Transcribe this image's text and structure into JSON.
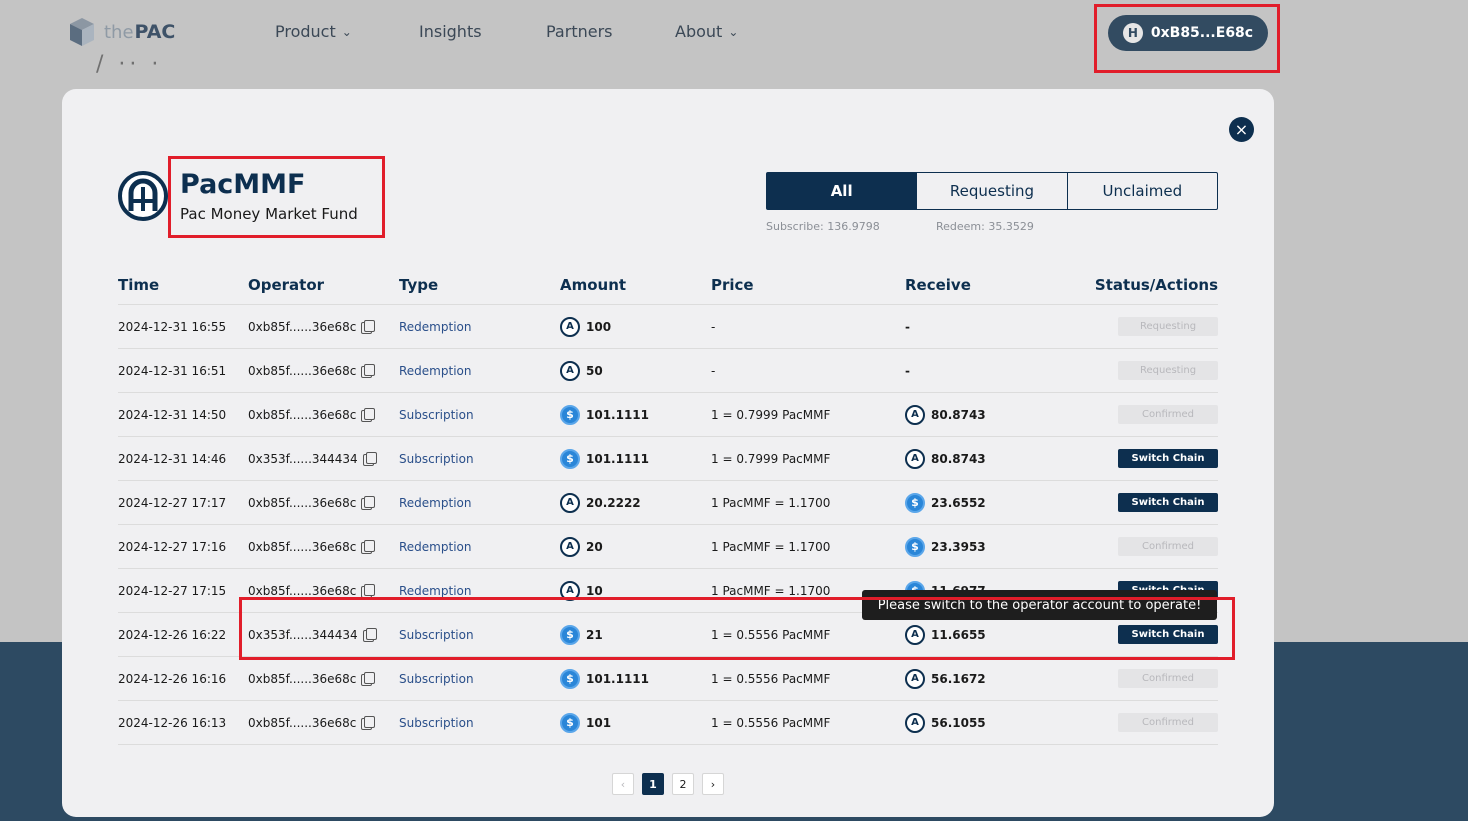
{
  "nav": {
    "logo_the": "the",
    "logo_pac": "PAC",
    "items": [
      {
        "label": "Product",
        "has_dropdown": true
      },
      {
        "label": "Insights",
        "has_dropdown": false
      },
      {
        "label": "Partners",
        "has_dropdown": false
      },
      {
        "label": "About",
        "has_dropdown": true
      }
    ],
    "wallet": {
      "address": "0xB85...E68c",
      "icon": "H"
    }
  },
  "modal": {
    "close_icon": "×",
    "fund": {
      "name": "PacMMF",
      "subtitle": "Pac Money Market Fund"
    },
    "tabs": [
      {
        "label": "All",
        "active": true
      },
      {
        "label": "Requesting",
        "active": false
      },
      {
        "label": "Unclaimed",
        "active": false
      }
    ],
    "summary": {
      "subscribe": "Subscribe: 136.9798",
      "redeem": "Redeem: 35.3529"
    },
    "columns": {
      "time": "Time",
      "operator": "Operator",
      "type": "Type",
      "amount": "Amount",
      "price": "Price",
      "receive": "Receive",
      "status": "Status/Actions"
    },
    "rows": [
      {
        "time": "2024-12-31 16:55",
        "operator": "0xb85f......36e68c",
        "type": "Redemption",
        "amount_coin": "pac",
        "amount": "100",
        "price": "-",
        "receive_coin": "",
        "receive": "-",
        "status": "Requesting",
        "status_kind": "disabled"
      },
      {
        "time": "2024-12-31 16:51",
        "operator": "0xb85f......36e68c",
        "type": "Redemption",
        "amount_coin": "pac",
        "amount": "50",
        "price": "-",
        "receive_coin": "",
        "receive": "-",
        "status": "Requesting",
        "status_kind": "disabled"
      },
      {
        "time": "2024-12-31 14:50",
        "operator": "0xb85f......36e68c",
        "type": "Subscription",
        "amount_coin": "usd",
        "amount": "101.1111",
        "price": "1 = 0.7999 PacMMF",
        "receive_coin": "pac",
        "receive": "80.8743",
        "status": "Confirmed",
        "status_kind": "disabled"
      },
      {
        "time": "2024-12-31 14:46",
        "operator": "0x353f......344434",
        "type": "Subscription",
        "amount_coin": "usd",
        "amount": "101.1111",
        "price": "1 = 0.7999 PacMMF",
        "receive_coin": "pac",
        "receive": "80.8743",
        "status": "Switch Chain",
        "status_kind": "action"
      },
      {
        "time": "2024-12-27 17:17",
        "operator": "0xb85f......36e68c",
        "type": "Redemption",
        "amount_coin": "pac",
        "amount": "20.2222",
        "price": "1 PacMMF = 1.1700",
        "receive_coin": "usd",
        "receive": "23.6552",
        "status": "Switch Chain",
        "status_kind": "action"
      },
      {
        "time": "2024-12-27 17:16",
        "operator": "0xb85f......36e68c",
        "type": "Redemption",
        "amount_coin": "pac",
        "amount": "20",
        "price": "1 PacMMF = 1.1700",
        "receive_coin": "usd",
        "receive": "23.3953",
        "status": "Confirmed",
        "status_kind": "disabled"
      },
      {
        "time": "2024-12-27 17:15",
        "operator": "0xb85f......36e68c",
        "type": "Redemption",
        "amount_coin": "pac",
        "amount": "10",
        "price": "1 PacMMF = 1.1700",
        "receive_coin": "usd",
        "receive": "11.6977",
        "status": "Switch Chain",
        "status_kind": "action"
      },
      {
        "time": "2024-12-26 16:22",
        "operator": "0x353f......344434",
        "type": "Subscription",
        "amount_coin": "usd",
        "amount": "21",
        "price": "1 = 0.5556 PacMMF",
        "receive_coin": "pac",
        "receive": "11.6655",
        "status": "Switch Chain",
        "status_kind": "action"
      },
      {
        "time": "2024-12-26 16:16",
        "operator": "0xb85f......36e68c",
        "type": "Subscription",
        "amount_coin": "usd",
        "amount": "101.1111",
        "price": "1 = 0.5556 PacMMF",
        "receive_coin": "pac",
        "receive": "56.1672",
        "status": "Confirmed",
        "status_kind": "disabled"
      },
      {
        "time": "2024-12-26 16:13",
        "operator": "0xb85f......36e68c",
        "type": "Subscription",
        "amount_coin": "usd",
        "amount": "101",
        "price": "1 = 0.5556 PacMMF",
        "receive_coin": "pac",
        "receive": "56.1055",
        "status": "Confirmed",
        "status_kind": "disabled"
      }
    ],
    "tooltip": "Please switch to the operator account to operate!",
    "pagination": {
      "prev": "‹",
      "pages": [
        "1",
        "2"
      ],
      "current": "1",
      "next": "›"
    }
  },
  "coin_symbols": {
    "pac": "A",
    "usd": "$"
  },
  "colors": {
    "brand": "#0d2f4f",
    "link": "#2a4f8a",
    "highlight": "#e11d2a"
  }
}
